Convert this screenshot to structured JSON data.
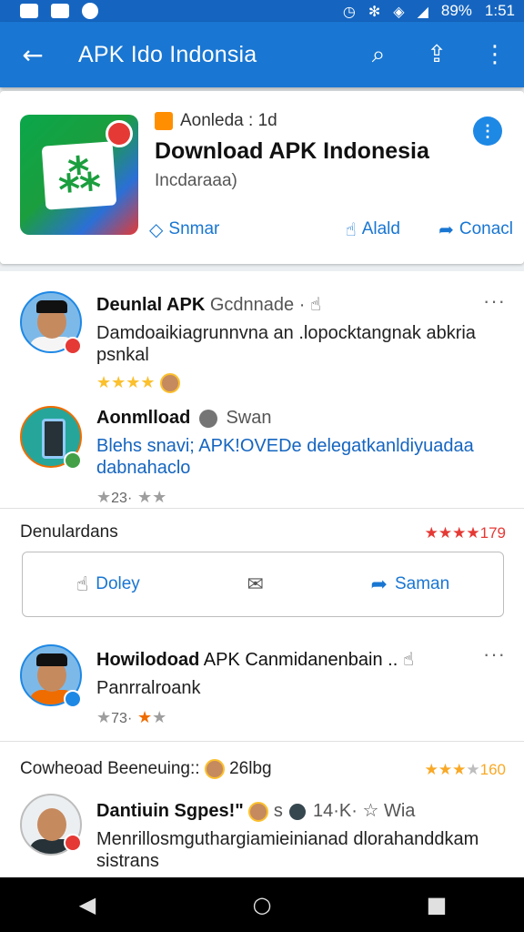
{
  "status_bar": {
    "battery": "89%",
    "time": "1:51"
  },
  "app_bar": {
    "title": "APK Ido Indonsia"
  },
  "header_card": {
    "developer": "Aonleda : 1d",
    "title": "Download APK Indonesia",
    "subtitle": "Incdaraaa)",
    "actions": [
      "Snmar",
      "Alald",
      "Conacl"
    ],
    "accent_color": "#1976d2"
  },
  "posts": [
    {
      "author": "Deunlal APK",
      "meta": "Gcdnnade ·",
      "text": "Damdoaikiagrunnvna an .lopocktangnak abkria psnkal"
    },
    {
      "author": "Aonmlload",
      "meta": "Swan",
      "text": "Blehs snavi; APK!OVEDe delegatkanldiyuadaa dabnahaclo",
      "count": "23·"
    }
  ],
  "section1": {
    "label": "Denulardans",
    "rating": "179",
    "actions": [
      "Doley",
      "",
      "Saman"
    ]
  },
  "post3": {
    "author": "Howilodoad",
    "meta": "APK Canmidanenbain ..",
    "text": "Panrralroank",
    "count": "73·"
  },
  "section2": {
    "label": "Cowheoad Beeneuing::",
    "meta": "26lbg",
    "rating": "160"
  },
  "post4": {
    "author": "Dantiuin Sgpes!\"",
    "meta_a": "s",
    "meta_b": "14·K·",
    "meta_c": "Wia",
    "text": "Menrillosmguthargiamieinianad dlorahanddkam sistrans"
  }
}
